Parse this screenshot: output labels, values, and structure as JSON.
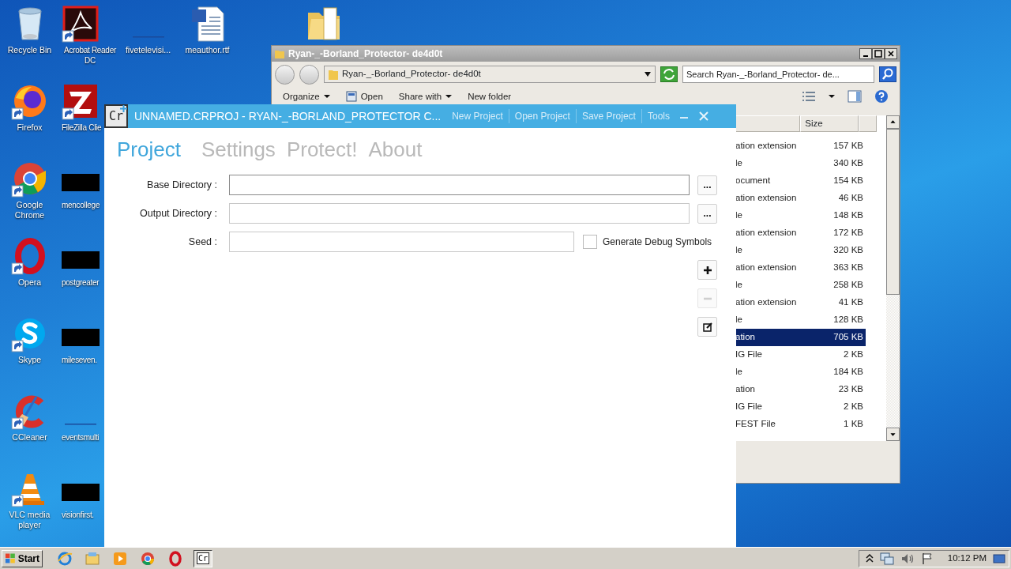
{
  "desktop": {
    "columns": [
      [
        {
          "kind": "recycle-bin",
          "label": "Recycle Bin",
          "shortcut": false
        },
        {
          "kind": "firefox",
          "label": "Firefox",
          "shortcut": true
        },
        {
          "kind": "chrome",
          "label": "Google Chrome",
          "shortcut": true
        },
        {
          "kind": "opera",
          "label": "Opera",
          "shortcut": true
        },
        {
          "kind": "skype",
          "label": "Skype",
          "shortcut": true
        },
        {
          "kind": "ccleaner",
          "label": "CCleaner",
          "shortcut": true
        },
        {
          "kind": "vlc",
          "label": "VLC media player",
          "shortcut": true
        }
      ],
      [
        {
          "kind": "acrobat",
          "label": "Acrobat Reader DC",
          "shortcut": true
        },
        {
          "kind": "filezilla",
          "label": "FileZilla Clie",
          "shortcut": true
        },
        {
          "kind": "redacted",
          "label": "mencollege",
          "shortcut": false
        },
        {
          "kind": "redacted",
          "label": "postgreater",
          "shortcut": false
        },
        {
          "kind": "redacted",
          "label": "mileseven.",
          "shortcut": false
        },
        {
          "kind": "blank",
          "label": "eventsmulti",
          "shortcut": false
        },
        {
          "kind": "redacted",
          "label": "visionfirst.",
          "shortcut": false
        }
      ],
      [
        {
          "kind": "blank",
          "label": "fivetelevisi...",
          "shortcut": false
        }
      ],
      [
        {
          "kind": "word",
          "label": "meauthor.rtf",
          "shortcut": false
        }
      ],
      [
        {
          "kind": "folder",
          "shortcut": false
        }
      ]
    ]
  },
  "explorer": {
    "title": "Ryan-_-Borland_Protector- de4d0t",
    "address": "Ryan-_-Borland_Protector- de4d0t",
    "search": {
      "placeholder": "Search Ryan-_-Borland_Protector- de..."
    },
    "toolbar": [
      {
        "label": "Organize",
        "kind": "dropdown"
      },
      {
        "label": "Open",
        "kind": "open"
      },
      {
        "label": "Share with",
        "kind": "dropdown"
      },
      {
        "label": "New folder",
        "kind": "plain"
      }
    ],
    "columns": [
      "Size"
    ],
    "rows": [
      {
        "type": "ation extension",
        "size": "157 KB",
        "selected": false
      },
      {
        "type": "le",
        "size": "340 KB",
        "selected": false
      },
      {
        "type": "ocument",
        "size": "154 KB",
        "selected": false
      },
      {
        "type": "ation extension",
        "size": "46 KB",
        "selected": false
      },
      {
        "type": "le",
        "size": "148 KB",
        "selected": false
      },
      {
        "type": "ation extension",
        "size": "172 KB",
        "selected": false
      },
      {
        "type": "le",
        "size": "320 KB",
        "selected": false
      },
      {
        "type": "ation extension",
        "size": "363 KB",
        "selected": false
      },
      {
        "type": "le",
        "size": "258 KB",
        "selected": false
      },
      {
        "type": "ation extension",
        "size": "41 KB",
        "selected": false
      },
      {
        "type": "le",
        "size": "128 KB",
        "selected": false
      },
      {
        "type": "ation",
        "size": "705 KB",
        "selected": true
      },
      {
        "type": "IG File",
        "size": "2 KB",
        "selected": false
      },
      {
        "type": "le",
        "size": "184 KB",
        "selected": false
      },
      {
        "type": "ation",
        "size": "23 KB",
        "selected": false
      },
      {
        "type": "IG File",
        "size": "2 KB",
        "selected": false
      },
      {
        "type": "FEST File",
        "size": "1 KB",
        "selected": false
      }
    ]
  },
  "app": {
    "logo": "Cr",
    "title": "UNNAMED.CRPROJ - RYAN-_-BORLAND_PROTECTOR C...",
    "menu": [
      "New Project",
      "Open Project",
      "Save Project",
      "Tools"
    ],
    "tabs": [
      {
        "label": "Project",
        "selected": true
      },
      {
        "label": "Settings",
        "selected": false
      },
      {
        "label": "Protect!",
        "selected": false
      },
      {
        "label": "About",
        "selected": false
      }
    ],
    "fields": [
      {
        "label": "Base Directory :",
        "kind": "browse",
        "button": "..."
      },
      {
        "label": "Output Directory :",
        "kind": "browse",
        "button": "..."
      },
      {
        "label": "Seed :",
        "kind": "seed"
      }
    ],
    "checkbox": {
      "label": "Generate Debug Symbols",
      "checked": false
    },
    "side_buttons": [
      {
        "kind": "add",
        "disabled": false
      },
      {
        "kind": "remove",
        "disabled": true
      },
      {
        "kind": "edit",
        "disabled": false
      }
    ]
  },
  "taskbar": {
    "start": "Start",
    "apps": [
      {
        "kind": "ie",
        "active": false
      },
      {
        "kind": "explorer",
        "active": false
      },
      {
        "kind": "media",
        "active": false
      },
      {
        "kind": "chrome",
        "active": false
      },
      {
        "kind": "opera",
        "active": false
      },
      {
        "kind": "cr",
        "text": "Cr",
        "active": true
      }
    ],
    "clock": "10:12 PM"
  }
}
